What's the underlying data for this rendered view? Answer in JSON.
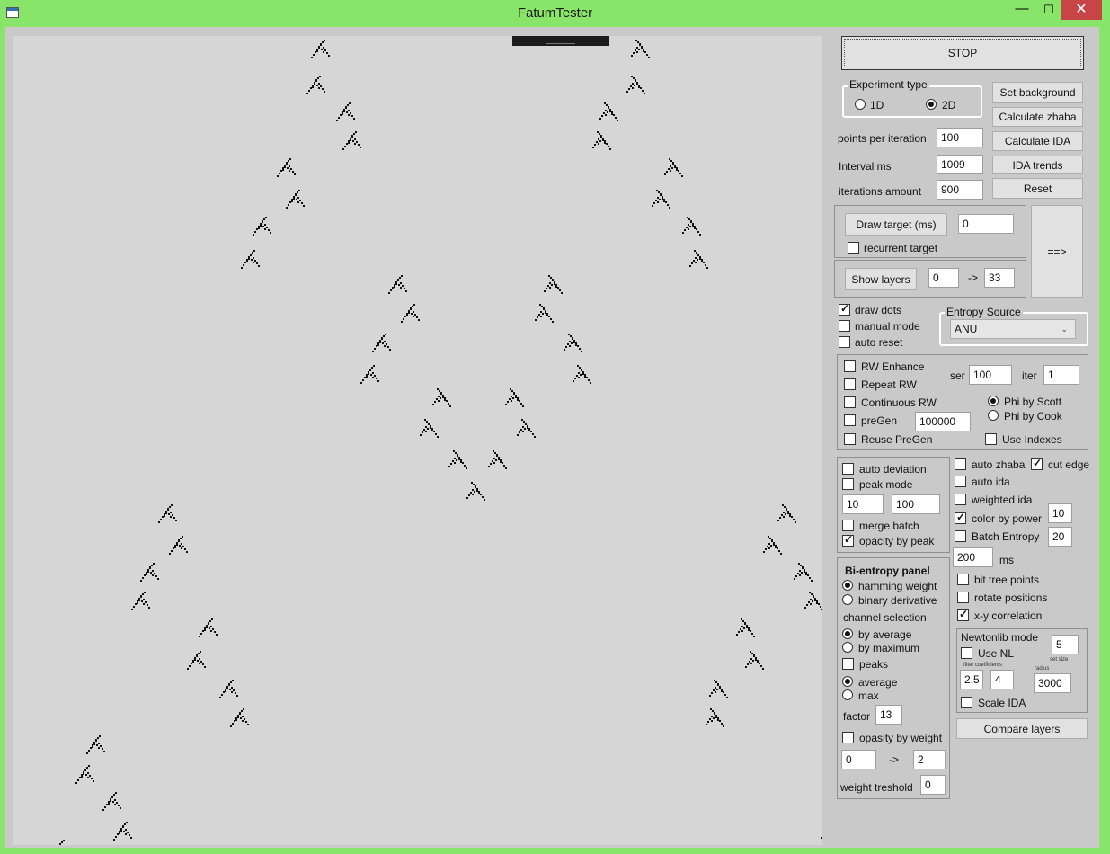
{
  "window": {
    "title": "FatumTester",
    "minimize": "—",
    "maximize": "☐",
    "close": "✕"
  },
  "controls": {
    "stop": "STOP",
    "experiment_type": {
      "legend": "Experiment type",
      "opt_1d": "1D",
      "opt_2d": "2D",
      "selected": "2D"
    },
    "set_background": "Set background",
    "calculate_zhaba": "Calculate zhaba",
    "calculate_ida": "Calculate IDA",
    "ida_trends": "IDA trends",
    "reset": "Reset",
    "points_per_iteration": {
      "label": "points per iteration",
      "value": "100"
    },
    "interval_ms": {
      "label": "Interval ms",
      "value": "1009"
    },
    "iterations_amount": {
      "label": "iterations amount",
      "value": "900"
    },
    "draw_target": {
      "label": "Draw target (ms)",
      "value": "0"
    },
    "recurrent_target": "recurrent target",
    "show_layers": {
      "label": "Show layers",
      "from": "0",
      "arrow": "->",
      "to": "33"
    },
    "arrow_button": "==>",
    "draw_dots": "draw dots",
    "manual_mode": "manual mode",
    "auto_reset": "auto reset",
    "entropy_source": {
      "legend": "Entropy Source",
      "value": "ANU"
    }
  },
  "rw_panel": {
    "rw_enhance": "RW Enhance",
    "repeat_rw": "Repeat RW",
    "continuous_rw": "Continuous  RW",
    "pregen": "preGen",
    "reuse_pregen": "Reuse PreGen",
    "ser_label": "ser",
    "ser_value": "100",
    "iter_label": "iter",
    "iter_value": "1",
    "pregen_value": "100000",
    "phi_scott": "Phi by Scott",
    "phi_cook": "Phi by Cook",
    "use_indexes": "Use Indexes"
  },
  "deviation_panel": {
    "auto_deviation": "auto deviation",
    "peak_mode": "peak mode",
    "value_a": "10",
    "value_b": "100",
    "merge_batch": "merge batch",
    "opacity_by_peak": "opacity by peak"
  },
  "bi_entropy": {
    "title": "Bi-entropy panel",
    "hamming_weight": "hamming weight",
    "binary_derivative": "binary derivative",
    "channel_selection": "channel selection",
    "by_average": "by average",
    "by_maximum": "by maximum",
    "peaks": "peaks",
    "average": "average",
    "max": "max",
    "factor_label": "factor",
    "factor_value": "13",
    "opasity_by_weight": "opasity by weight",
    "range_from": "0",
    "range_arrow": "->",
    "range_to": "2",
    "weight_treshold_label": "weight treshold",
    "weight_treshold_value": "0"
  },
  "right_options": {
    "auto_zhaba": "auto zhaba",
    "cut_edge": "cut edge",
    "auto_ida": "auto ida",
    "weighted_ida": "weighted ida",
    "color_by_power": "color by power",
    "color_by_power_value": "10",
    "batch_entropy": "Batch Entropy",
    "batch_entropy_value": "20",
    "ms_value": "200",
    "ms_label": "ms",
    "bit_tree_points": "bit tree points",
    "rotate_positions": "rotate positions",
    "xy_correlation": "x-y correlation"
  },
  "newtonlib": {
    "title": "Newtonlib mode",
    "use_nl": "Use NL",
    "set_size_value": "5",
    "set_size_label": "set size",
    "filter_coefficients": "filter coefficients",
    "coef_a": "2.5",
    "coef_b": "4",
    "radius_label": "radius",
    "radius_value": "3000",
    "scale_ida": "Scale IDA"
  },
  "compare_layers": "Compare layers",
  "colors": {
    "title_bar": "#89e46a",
    "close_button": "#c74545",
    "panel": "#c9c9c9",
    "canvas": "#d6d6d6",
    "dots": "#111111"
  },
  "chart_data": {
    "type": "scatter",
    "description_values": "sierpinski-like fractal dot clusters",
    "clusters": [
      [
        350,
        48
      ],
      [
        705,
        48
      ],
      [
        345,
        88
      ],
      [
        700,
        88
      ],
      [
        378,
        118
      ],
      [
        670,
        118
      ],
      [
        385,
        150
      ],
      [
        662,
        150
      ],
      [
        312,
        180
      ],
      [
        742,
        180
      ],
      [
        322,
        215
      ],
      [
        728,
        215
      ],
      [
        285,
        245
      ],
      [
        762,
        245
      ],
      [
        272,
        282
      ],
      [
        770,
        282
      ],
      [
        436,
        310
      ],
      [
        608,
        310
      ],
      [
        450,
        342
      ],
      [
        598,
        342
      ],
      [
        418,
        375
      ],
      [
        630,
        375
      ],
      [
        405,
        410
      ],
      [
        640,
        410
      ],
      [
        484,
        436
      ],
      [
        565,
        436
      ],
      [
        470,
        470
      ],
      [
        578,
        470
      ],
      [
        502,
        505
      ],
      [
        546,
        505
      ],
      [
        522,
        540
      ],
      [
        180,
        565
      ],
      [
        868,
        565
      ],
      [
        192,
        600
      ],
      [
        852,
        600
      ],
      [
        160,
        630
      ],
      [
        886,
        630
      ],
      [
        150,
        662
      ],
      [
        898,
        662
      ],
      [
        225,
        692
      ],
      [
        822,
        692
      ],
      [
        212,
        728
      ],
      [
        832,
        728
      ],
      [
        248,
        760
      ],
      [
        792,
        760
      ],
      [
        260,
        792
      ],
      [
        788,
        792
      ],
      [
        100,
        822
      ],
      [
        88,
        855
      ],
      [
        118,
        885
      ],
      [
        130,
        918
      ],
      [
        60,
        938
      ],
      [
        912,
        935
      ]
    ]
  }
}
